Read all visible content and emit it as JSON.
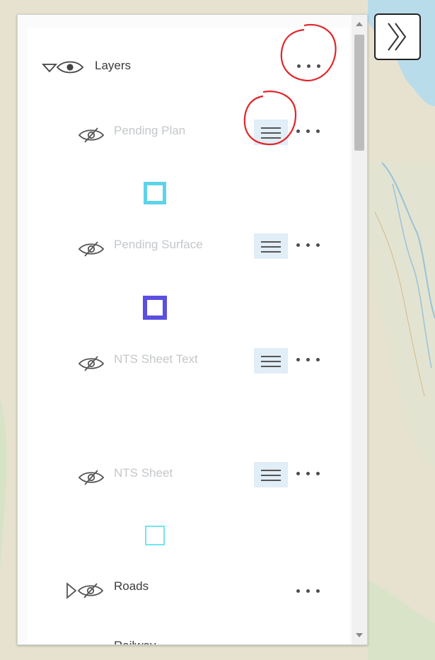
{
  "map": {
    "land_color": "#e7e2cf",
    "water_color": "#b9dceb",
    "road_color": "#d6b98a"
  },
  "expand_button": {
    "icon": "double-chevron-right-icon"
  },
  "layer_list": {
    "title": "Layers",
    "group_icons": [
      "collapse-triangle-icon",
      "eye-icon"
    ],
    "more_icon": "ellipsis-icon",
    "layers": [
      {
        "label": "Pending Plan",
        "visible": false,
        "has_legend_button": true,
        "legend_swatch_color": "#5dd3ea"
      },
      {
        "label": "Pending Surface",
        "visible": false,
        "has_legend_button": true,
        "legend_swatch_color": "#5a4fe0"
      },
      {
        "label": "NTS Sheet Text",
        "visible": false,
        "has_legend_button": true
      },
      {
        "label": "NTS Sheet",
        "visible": false,
        "has_legend_button": true,
        "legend_swatch_color": "#6fe7ef"
      },
      {
        "label": "Roads",
        "visible": false,
        "has_legend_button": false,
        "expandable": true
      },
      {
        "label": "Railway",
        "visible": false,
        "has_legend_button": true
      }
    ]
  },
  "annotations": {
    "circle_color": "#e0262b"
  }
}
